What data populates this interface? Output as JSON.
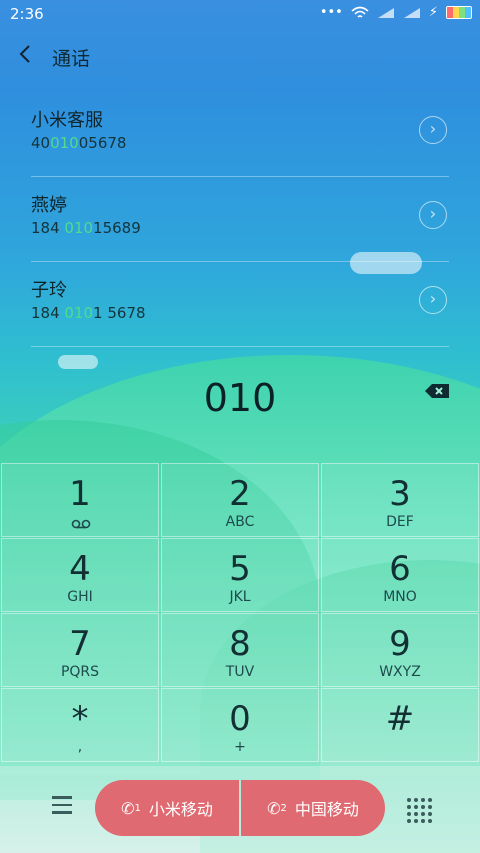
{
  "status": {
    "time": "2:36",
    "icons": [
      "more-icon",
      "wifi-icon",
      "signal-1-icon",
      "signal-2-icon",
      "charging-icon",
      "battery-icon"
    ]
  },
  "header": {
    "title": "通话"
  },
  "contacts": [
    {
      "name": "小米客服",
      "num_pre": "40",
      "num_hl": "010",
      "num_post": "05678"
    },
    {
      "name": "燕婷",
      "num_pre": "184 ",
      "num_hl": "010",
      "num_post": "15689"
    },
    {
      "name": "子玲",
      "num_pre": "184 ",
      "num_hl": "010",
      "num_post": "1 5678"
    }
  ],
  "entry": {
    "value": "010"
  },
  "keys": [
    {
      "digit": "1",
      "letters": ""
    },
    {
      "digit": "2",
      "letters": "ABC"
    },
    {
      "digit": "3",
      "letters": "DEF"
    },
    {
      "digit": "4",
      "letters": "GHI"
    },
    {
      "digit": "5",
      "letters": "JKL"
    },
    {
      "digit": "6",
      "letters": "MNO"
    },
    {
      "digit": "7",
      "letters": "PQRS"
    },
    {
      "digit": "8",
      "letters": "TUV"
    },
    {
      "digit": "9",
      "letters": "WXYZ"
    },
    {
      "digit": "*",
      "letters": ","
    },
    {
      "digit": "0",
      "letters": "+"
    },
    {
      "digit": "#",
      "letters": ""
    }
  ],
  "bottom": {
    "sim1_label": "小米移动",
    "sim2_label": "中国移动",
    "sim1_index": "1",
    "sim2_index": "2"
  },
  "colors": {
    "accent": "#e06a71",
    "highlight": "#4fdc8c"
  }
}
